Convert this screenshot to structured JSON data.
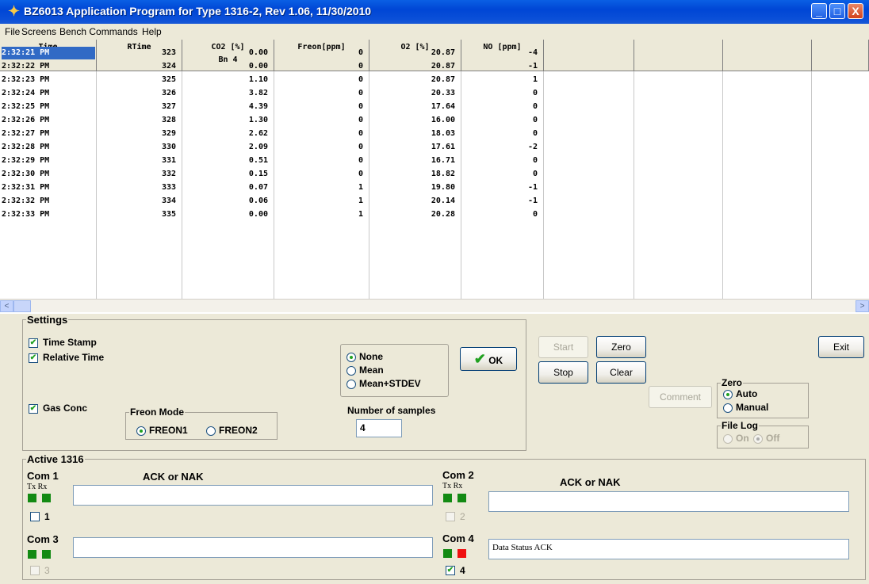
{
  "window": {
    "title": "BZ6013 Application Program for Type 1316-2, Rev 1.06, 11/30/2010",
    "minimize_glyph": "_",
    "maximize_glyph": "□",
    "close_glyph": "X"
  },
  "menu": [
    "File",
    "Screens",
    "Bench Commands",
    "Help"
  ],
  "table": {
    "headers": [
      {
        "label": "Time",
        "sub": ""
      },
      {
        "label": "RTime",
        "sub": ""
      },
      {
        "label": "CO2 [%]",
        "sub": "Bn 4"
      },
      {
        "label": "Freon[ppm]",
        "sub": ""
      },
      {
        "label": "O2 [%]",
        "sub": ""
      },
      {
        "label": "NO [ppm]",
        "sub": ""
      },
      {
        "label": "",
        "sub": ""
      },
      {
        "label": "",
        "sub": ""
      },
      {
        "label": "",
        "sub": ""
      },
      {
        "label": "",
        "sub": ""
      }
    ],
    "rows": [
      [
        "2:32:21 PM",
        "323",
        "0.00",
        "0",
        "20.87",
        "-4"
      ],
      [
        "2:32:22 PM",
        "324",
        "0.00",
        "0",
        "20.87",
        "-1"
      ],
      [
        "2:32:23 PM",
        "325",
        "1.10",
        "0",
        "20.87",
        "1"
      ],
      [
        "2:32:24 PM",
        "326",
        "3.82",
        "0",
        "20.33",
        "0"
      ],
      [
        "2:32:25 PM",
        "327",
        "4.39",
        "0",
        "17.64",
        "0"
      ],
      [
        "2:32:26 PM",
        "328",
        "1.30",
        "0",
        "16.00",
        "0"
      ],
      [
        "2:32:27 PM",
        "329",
        "2.62",
        "0",
        "18.03",
        "0"
      ],
      [
        "2:32:28 PM",
        "330",
        "2.09",
        "0",
        "17.61",
        "-2"
      ],
      [
        "2:32:29 PM",
        "331",
        "0.51",
        "0",
        "16.71",
        "0"
      ],
      [
        "2:32:30 PM",
        "332",
        "0.15",
        "0",
        "18.82",
        "0"
      ],
      [
        "2:32:31 PM",
        "333",
        "0.07",
        "1",
        "19.80",
        "-1"
      ],
      [
        "2:32:32 PM",
        "334",
        "0.06",
        "1",
        "20.14",
        "-1"
      ],
      [
        "2:32:33 PM",
        "335",
        "0.00",
        "1",
        "20.28",
        "0"
      ]
    ],
    "selected_row": 0
  },
  "scroll": {
    "left_arrow": "<",
    "right_arrow": ">"
  },
  "settings": {
    "title": "Settings",
    "time_stamp": {
      "label": "Time Stamp",
      "checked": true
    },
    "relative_time": {
      "label": "Relative Time",
      "checked": true
    },
    "gas_conc": {
      "label": "Gas Conc",
      "checked": true
    },
    "freon_mode": {
      "title": "Freon Mode",
      "opt1": "FREON1",
      "opt2": "FREON2",
      "selected": "FREON1"
    },
    "averaging": {
      "none": "None",
      "mean": "Mean",
      "mean_stdev": "Mean+STDEV",
      "selected": "None"
    },
    "samples_label": "Number of samples",
    "samples_value": "4",
    "ok_label": "OK",
    "check_glyph": "✔"
  },
  "buttons": {
    "start": "Start",
    "zero": "Zero",
    "stop": "Stop",
    "clear": "Clear",
    "comment": "Comment",
    "exit": "Exit"
  },
  "zero_group": {
    "title": "Zero",
    "auto": "Auto",
    "manual": "Manual",
    "selected": "Auto"
  },
  "file_log": {
    "title": "File Log",
    "on": "On",
    "off": "Off",
    "selected": "Off"
  },
  "active": {
    "title": "Active 1316",
    "ack_nak": "ACK or NAK",
    "tx_rx": "Tx Rx",
    "com1": {
      "label": "Com 1",
      "num": "1",
      "text": ""
    },
    "com2": {
      "label": "Com 2",
      "num": "2",
      "text": ""
    },
    "com3": {
      "label": "Com 3",
      "num": "3",
      "text": ""
    },
    "com4": {
      "label": "Com 4",
      "num": "4",
      "text": "Data Status  ACK"
    }
  },
  "colors": {
    "led_green": "#138a13",
    "led_red": "#f01010",
    "selection": "#316ac5"
  }
}
